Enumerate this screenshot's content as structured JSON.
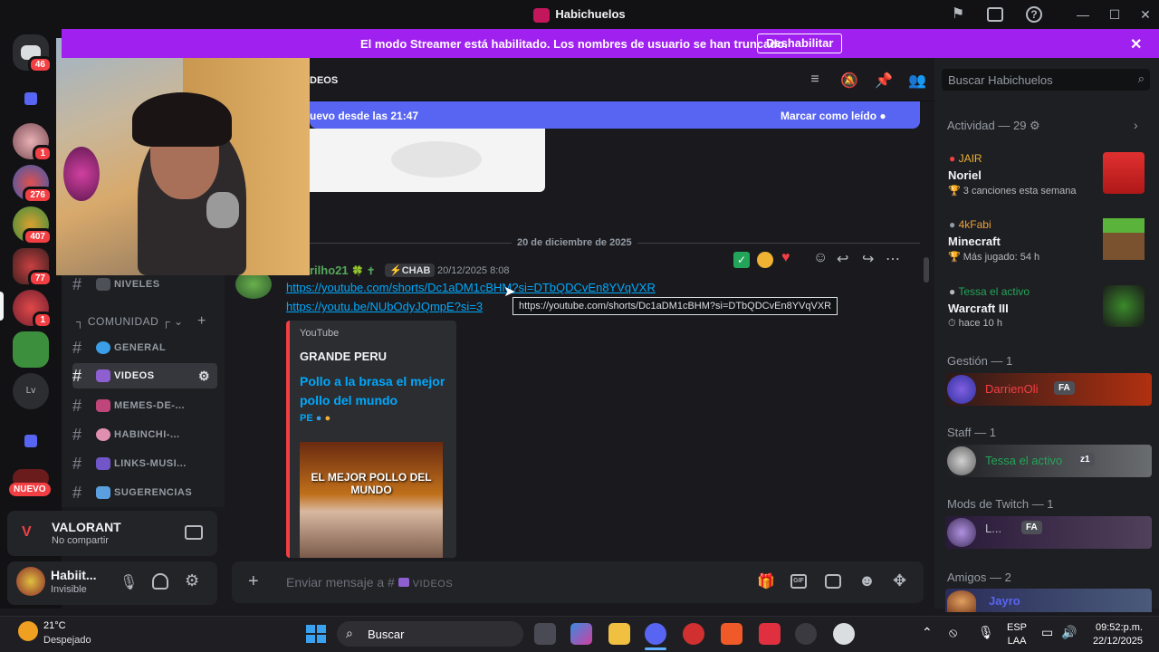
{
  "window": {
    "title": "Habichuelos"
  },
  "banner": {
    "text": "El modo Streamer está habilitado. Los nombres de usuario se han truncado.",
    "button": "Deshabilitar"
  },
  "rail": {
    "servers": [
      {
        "badge": "46"
      },
      {
        "badge": ""
      },
      {
        "badge": "1"
      },
      {
        "badge": "276"
      },
      {
        "badge": "407"
      },
      {
        "badge": "77"
      },
      {
        "badge": "1"
      },
      {
        "badge": ""
      },
      {
        "badge": ""
      },
      {
        "badge": ""
      }
    ],
    "new_label": "NUEVO"
  },
  "channel_header": {
    "name_fragment": "DEOS"
  },
  "channels": {
    "niveles": "NIVELES",
    "category": "COMUNIDAD",
    "items": [
      "GENERAL",
      "VIDEOS",
      "MEMES-DE-...",
      "HABINCHI-...",
      "LINKS-MUSI...",
      "SUGERENCIAS"
    ]
  },
  "activity_game": {
    "name": "VALORANT",
    "status": "No compartir"
  },
  "user": {
    "name": "Habiit...",
    "status": "Invisible"
  },
  "new_messages": {
    "text": "uevo desde las 21:47",
    "mark_read": "Marcar como leído"
  },
  "date_divider": "20 de diciembre de 2025",
  "message": {
    "author": "rilho21",
    "tag": "CHAB",
    "timestamp": "20/12/2025 8:08",
    "link1": "https://youtube.com/shorts/Dc1aDM1cBHM?si=DTbQDCvEn8YVqVXR",
    "link2": "https://youtu.be/NUbOdyJQmpE?si=3",
    "tooltip": "https://youtube.com/shorts/Dc1aDM1cBHM?si=DTbQDCvEn8YVqVXR"
  },
  "embed": {
    "provider": "YouTube",
    "author": "GRANDE PERU",
    "title": "Pollo a la brasa el mejor pollo del mundo",
    "flag": "PE",
    "thumb_text": "EL MEJOR POLLO DEL MUNDO"
  },
  "composer": {
    "placeholder": "Enviar mensaje a #",
    "channel": "VIDEOS"
  },
  "search": {
    "placeholder": "Buscar Habichuelos"
  },
  "members": {
    "activity_header": "Actividad — 29",
    "activities": [
      {
        "user": "JAIR",
        "title": "Noriel",
        "detail": "3 canciones esta semana",
        "color": "#f0b232"
      },
      {
        "user": "4kFabi",
        "title": "Minecraft",
        "detail": "Más jugado: 54 h",
        "color": "#e9a13b"
      },
      {
        "user": "Tessa el activo",
        "title": "Warcraft III",
        "detail": "hace 10 h",
        "color": "#23a559"
      }
    ],
    "groups": [
      {
        "header": "Gestión — 1",
        "name": "DarrienOli",
        "tag": "FA",
        "color": "#f23f43"
      },
      {
        "header": "Staff — 1",
        "name": "Tessa el activo",
        "tag": "z1",
        "color": "#23a559"
      },
      {
        "header": "Mods de Twitch — 1",
        "name": "L...",
        "tag": "FA",
        "color": "#b5bac1"
      },
      {
        "header": "Amigos — 2",
        "name": "Jayro",
        "tag": "",
        "color": "#5865f2"
      }
    ]
  },
  "taskbar": {
    "weather_temp": "21°C",
    "weather_desc": "Despejado",
    "search": "Buscar",
    "lang1": "ESP",
    "lang2": "LAA",
    "time": "09:52:p.m.",
    "date": "22/12/2025"
  }
}
